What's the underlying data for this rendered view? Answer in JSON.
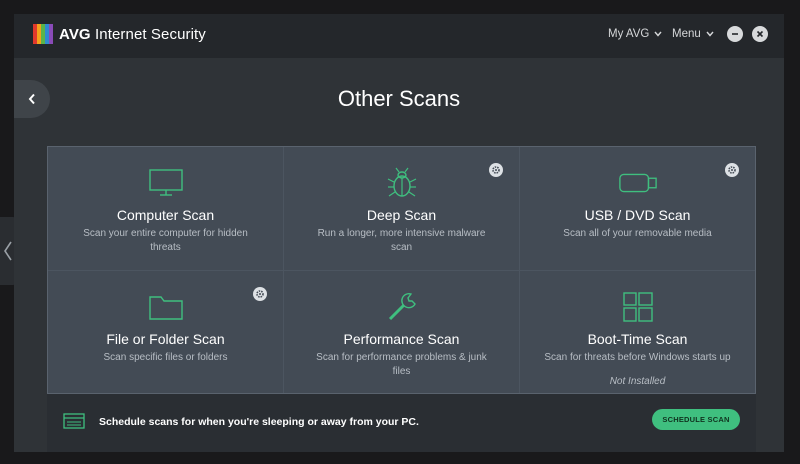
{
  "app": {
    "brand": "AVG",
    "product": "Internet Security"
  },
  "top_menu": {
    "my_avg": "My AVG",
    "menu": "Menu"
  },
  "window_controls": {
    "minimize_icon": "minus-icon",
    "close_icon": "close-icon"
  },
  "page": {
    "title": "Other Scans"
  },
  "tiles": [
    {
      "title": "Computer Scan",
      "desc": "Scan your entire computer for hidden threats",
      "icon": "monitor-icon",
      "settings": false,
      "status": ""
    },
    {
      "title": "Deep Scan",
      "desc": "Run a longer, more intensive malware scan",
      "icon": "bug-icon",
      "settings": true,
      "status": ""
    },
    {
      "title": "USB / DVD Scan",
      "desc": "Scan all of your removable media",
      "icon": "usb-icon",
      "settings": true,
      "status": ""
    },
    {
      "title": "File or Folder Scan",
      "desc": "Scan specific files or folders",
      "icon": "folder-icon",
      "settings": true,
      "status": ""
    },
    {
      "title": "Performance Scan",
      "desc": "Scan for performance problems & junk files",
      "icon": "wrench-icon",
      "settings": false,
      "status": ""
    },
    {
      "title": "Boot-Time Scan",
      "desc": "Scan for threats before Windows starts up",
      "icon": "windows-icon",
      "settings": false,
      "status": "Not Installed"
    }
  ],
  "schedule": {
    "text": "Schedule scans for when you're sleeping or away from your PC.",
    "button": "SCHEDULE SCAN"
  },
  "colors": {
    "accent": "#3fbf7f",
    "tile_bg": "#434b55",
    "window_bg": "#2f3337",
    "icon_line": "#3fbf7f"
  }
}
